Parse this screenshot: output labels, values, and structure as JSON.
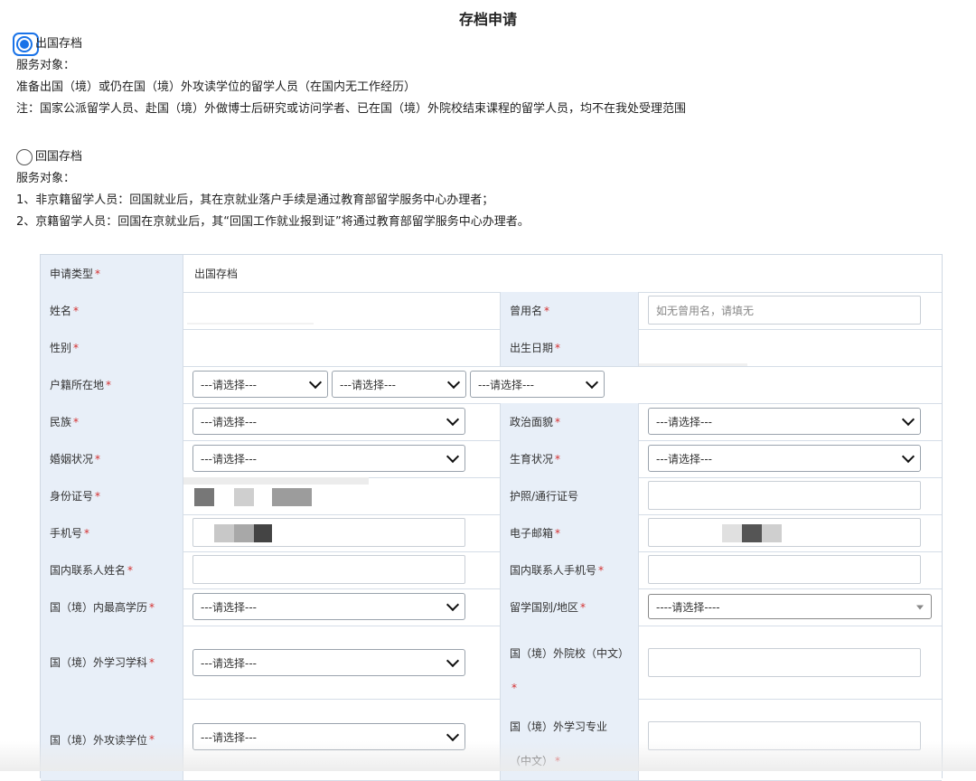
{
  "page": {
    "title": "存档申请"
  },
  "intro": {
    "option1": {
      "label": "出国存档",
      "selected": true,
      "service_title": "服务对象：",
      "service_desc": "准备出国（境）或仍在国（境）外攻读学位的留学人员（在国内无工作经历）",
      "note": "注：国家公派留学人员、赴国（境）外做博士后研究或访问学者、已在国（境）外院校结束课程的留学人员，均不在我处受理范围"
    },
    "option2": {
      "label": "回国存档",
      "selected": false,
      "service_title": "服务对象：",
      "item1": "1、非京籍留学人员：回国就业后，其在京就业落户手续是通过教育部留学服务中心办理者；",
      "item2": "2、京籍留学人员：回国在京就业后，其“回国工作就业报到证”将通过教育部留学服务中心办理者。"
    }
  },
  "form": {
    "required_mark": "*",
    "apply_type": {
      "label": "申请类型",
      "value": "出国存档"
    },
    "name": {
      "label": "姓名"
    },
    "former_name": {
      "label": "曾用名",
      "placeholder": "如无曾用名，请填无"
    },
    "gender": {
      "label": "性别"
    },
    "birth_date": {
      "label": "出生日期"
    },
    "hukou": {
      "label": "户籍所在地",
      "select1": "---请选择---",
      "select2": "---请选择---",
      "select3": "---请选择---"
    },
    "ethnicity": {
      "label": "民族",
      "value": "---请选择---"
    },
    "political": {
      "label": "政治面貌",
      "value": "---请选择---"
    },
    "marital": {
      "label": "婚姻状况",
      "value": "---请选择---"
    },
    "fertility": {
      "label": "生育状况",
      "value": "---请选择---"
    },
    "id_number": {
      "label": "身份证号"
    },
    "passport": {
      "label": "护照/通行证号"
    },
    "phone": {
      "label": "手机号"
    },
    "email": {
      "label": "电子邮箱"
    },
    "contact_name": {
      "label": "国内联系人姓名"
    },
    "contact_phone": {
      "label": "国内联系人手机号"
    },
    "domestic_edu": {
      "label": "国（境）内最高学历",
      "value": "---请选择---"
    },
    "study_country": {
      "label": "留学国别/地区",
      "value": "----请选择----"
    },
    "foreign_subject": {
      "label": "国（境）外学习学科",
      "value": "---请选择---"
    },
    "foreign_school": {
      "label": "国（境）外院校（中文）"
    },
    "foreign_degree": {
      "label": "国（境）外攻读学位",
      "value": "---请选择---"
    },
    "foreign_major": {
      "label": "国（境）外学习专业（中文）"
    }
  },
  "colors": {
    "accent": "#1a73e8",
    "label_bg": "#e8eff8",
    "required": "#d32f2f"
  }
}
